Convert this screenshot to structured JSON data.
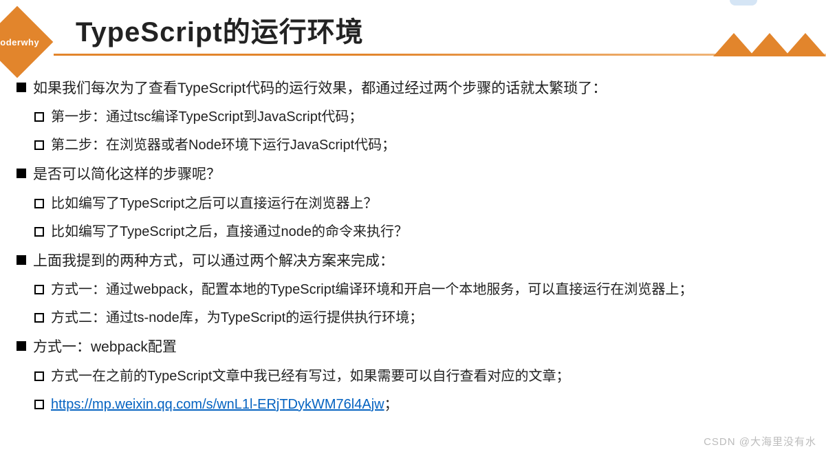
{
  "logo": {
    "text": "coderwhy"
  },
  "title": "TypeScript的运行环境",
  "watermark": "CSDN @大海里没有水",
  "sections": [
    {
      "text": "如果我们每次为了查看TypeScript代码的运行效果，都通过经过两个步骤的话就太繁琐了：",
      "subs": [
        {
          "text": "第一步：通过tsc编译TypeScript到JavaScript代码；"
        },
        {
          "text": "第二步：在浏览器或者Node环境下运行JavaScript代码；"
        }
      ]
    },
    {
      "text": "是否可以简化这样的步骤呢？",
      "subs": [
        {
          "text": "比如编写了TypeScript之后可以直接运行在浏览器上？"
        },
        {
          "text": "比如编写了TypeScript之后，直接通过node的命令来执行？"
        }
      ]
    },
    {
      "text": "上面我提到的两种方式，可以通过两个解决方案来完成：",
      "subs": [
        {
          "text": "方式一：通过webpack，配置本地的TypeScript编译环境和开启一个本地服务，可以直接运行在浏览器上；"
        },
        {
          "text": "方式二：通过ts-node库，为TypeScript的运行提供执行环境；"
        }
      ]
    },
    {
      "text": "方式一：webpack配置",
      "subs": [
        {
          "text": "方式一在之前的TypeScript文章中我已经有写过，如果需要可以自行查看对应的文章；"
        },
        {
          "link": "https://mp.weixin.qq.com/s/wnL1l-ERjTDykWM76l4Ajw",
          "suffix": "；"
        }
      ]
    }
  ]
}
